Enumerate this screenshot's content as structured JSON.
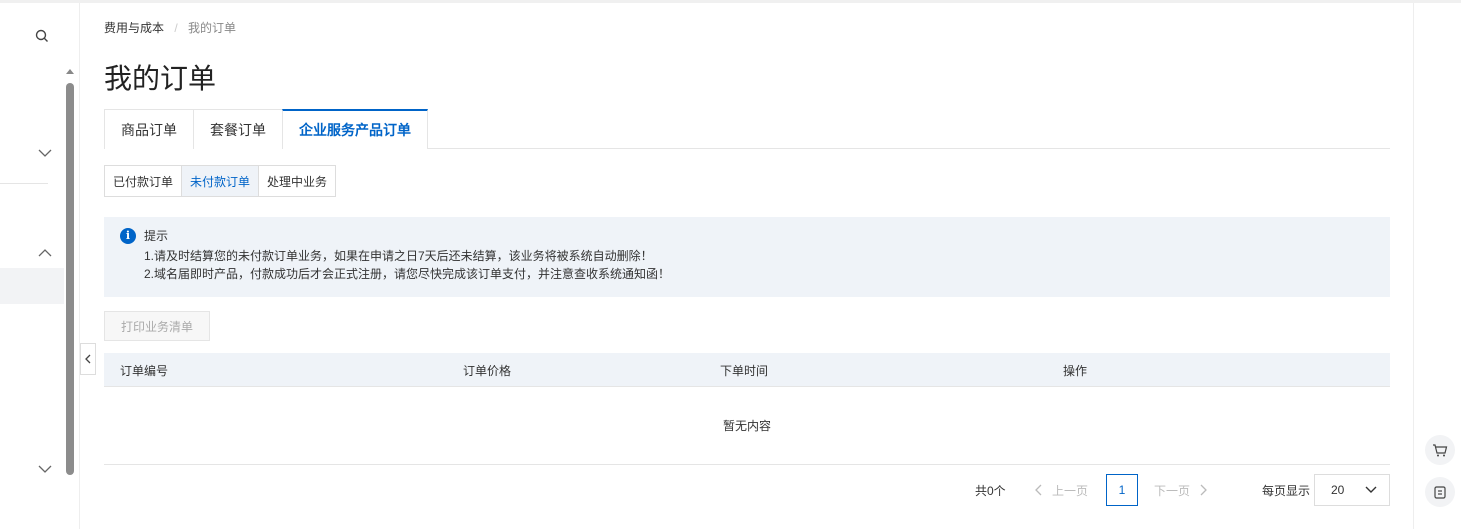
{
  "breadcrumb": {
    "parent": "费用与成本",
    "separator": "/",
    "current": "我的订单"
  },
  "page_title": "我的订单",
  "tabs": [
    {
      "label": "商品订单",
      "active": false
    },
    {
      "label": "套餐订单",
      "active": false
    },
    {
      "label": "企业服务产品订单",
      "active": true
    }
  ],
  "subtabs": [
    {
      "label": "已付款订单",
      "active": false
    },
    {
      "label": "未付款订单",
      "active": true
    },
    {
      "label": "处理中业务",
      "active": false
    }
  ],
  "notice": {
    "title": "提示",
    "lines": [
      "1.请及时结算您的未付款订单业务，如果在申请之日7天后还未结算，该业务将被系统自动删除！",
      "2.域名届即时产品，付款成功后才会正式注册，请您尽快完成该订单支付，并注意查收系统通知函！"
    ]
  },
  "toolbar": {
    "print_label": "打印业务清单"
  },
  "table": {
    "columns": [
      "订单编号",
      "订单价格",
      "下单时间",
      "操作"
    ],
    "empty_text": "暂无内容"
  },
  "pagination": {
    "total": "共0个",
    "prev": "上一页",
    "current_page": "1",
    "next": "下一页",
    "page_size_label": "每页显示",
    "page_size": "20"
  },
  "colors": {
    "accent": "#0064c8",
    "notice_bg": "#eff3f8"
  },
  "icons": [
    "search-icon",
    "chevron-down-icon",
    "chevron-up-icon",
    "chevron-left-icon",
    "info-icon",
    "cart-icon",
    "transfer-icon"
  ]
}
